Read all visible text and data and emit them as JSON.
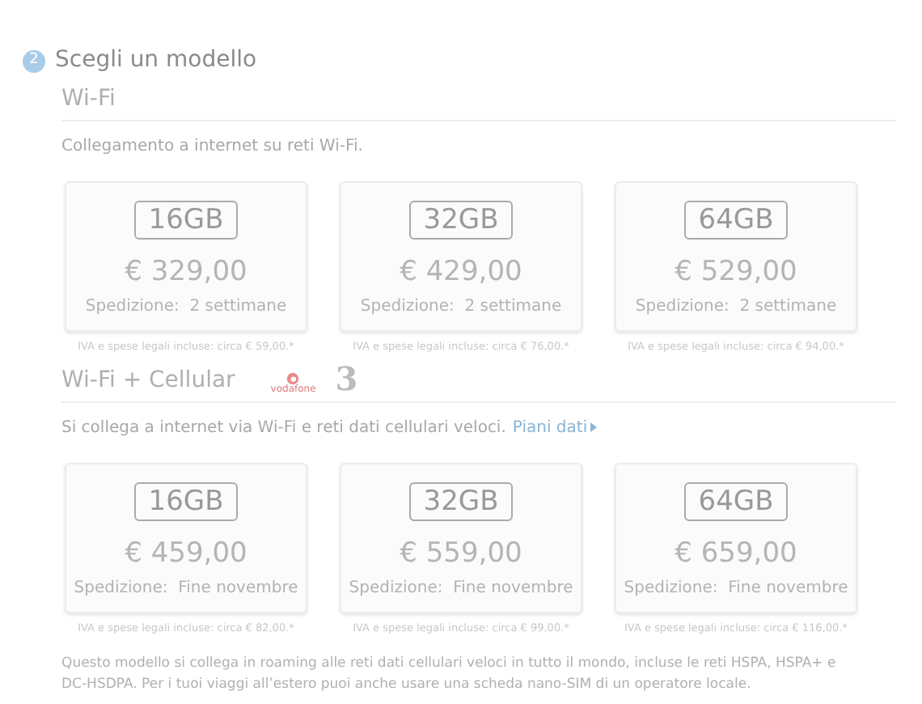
{
  "step": {
    "number": "2",
    "title": "Scegli un modello"
  },
  "sections": [
    {
      "title": "Wi-Fi",
      "description": "Collegamento a internet su reti Wi-Fi.",
      "models": [
        {
          "capacity": "16GB",
          "price": "€ 329,00",
          "shipping_label": "Spedizione:",
          "shipping": "2 settimane",
          "note": "IVA e spese legali incluse: circa € 59,00.*"
        },
        {
          "capacity": "32GB",
          "price": "€ 429,00",
          "shipping_label": "Spedizione:",
          "shipping": "2 settimane",
          "note": "IVA e spese legali incluse: circa € 76,00.*"
        },
        {
          "capacity": "64GB",
          "price": "€ 529,00",
          "shipping_label": "Spedizione:",
          "shipping": "2 settimane",
          "note": "IVA e spese legali incluse: circa € 94,00.*"
        }
      ]
    },
    {
      "title": "Wi-Fi + Cellular",
      "operators": [
        {
          "kind": "vodafone",
          "label": "vodafone"
        },
        {
          "kind": "three",
          "label": "3"
        }
      ],
      "description": "Si collega a internet via Wi-Fi e reti dati cellulari veloci.",
      "link": "Piani dati",
      "models": [
        {
          "capacity": "16GB",
          "price": "€ 459,00",
          "shipping_label": "Spedizione:",
          "shipping": "Fine novembre",
          "note": "IVA e spese legali incluse: circa € 82,00.*"
        },
        {
          "capacity": "32GB",
          "price": "€ 559,00",
          "shipping_label": "Spedizione:",
          "shipping": "Fine novembre",
          "note": "IVA e spese legali incluse: circa € 99,00.*"
        },
        {
          "capacity": "64GB",
          "price": "€ 659,00",
          "shipping_label": "Spedizione:",
          "shipping": "Fine novembre",
          "note": "IVA e spese legali incluse: circa € 116,00.*"
        }
      ]
    }
  ],
  "footnote": "Questo modello si collega in roaming alle reti dati cellulari veloci in tutto il mondo, incluse le reti HSPA, HSPA+ e DC-HSDPA. Per i tuoi viaggi all’estero puoi anche usare una scheda nano-SIM di un operatore locale."
}
